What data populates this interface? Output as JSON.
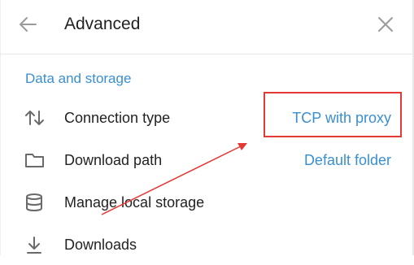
{
  "header": {
    "title": "Advanced",
    "back_icon": "arrow-left-icon",
    "close_icon": "close-icon"
  },
  "section": {
    "title": "Data and storage"
  },
  "rows": [
    {
      "label": "Connection type",
      "value": "TCP with proxy",
      "icon": "up-down-arrows-icon"
    },
    {
      "label": "Download path",
      "value": "Default folder",
      "icon": "folder-icon"
    },
    {
      "label": "Manage local storage",
      "value": "",
      "icon": "database-icon"
    },
    {
      "label": "Downloads",
      "value": "",
      "icon": "download-icon"
    }
  ],
  "colors": {
    "accent": "#3a8fd0",
    "annotation": "#e53935",
    "text": "#222222",
    "icon": "#7a7a7a"
  }
}
